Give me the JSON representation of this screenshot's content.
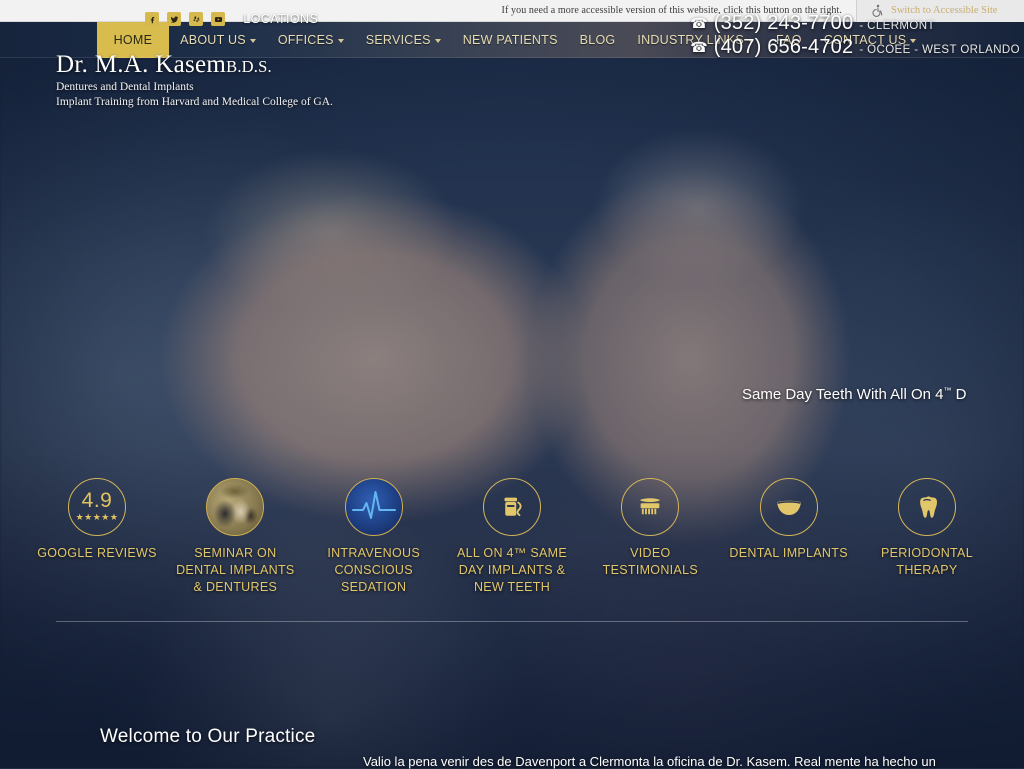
{
  "accessibility_bar": {
    "message": "If you need a more accessible version of this website, click this button on the right.",
    "button_label": "Switch to Accessible Site",
    "icon": "wheelchair-accessibility-icon"
  },
  "nav": {
    "items": [
      {
        "label": "HOME",
        "active": true,
        "has_dropdown": false
      },
      {
        "label": "ABOUT US",
        "active": false,
        "has_dropdown": true
      },
      {
        "label": "OFFICES",
        "active": false,
        "has_dropdown": true
      },
      {
        "label": "SERVICES",
        "active": false,
        "has_dropdown": true
      },
      {
        "label": "NEW PATIENTS",
        "active": false,
        "has_dropdown": false
      },
      {
        "label": "BLOG",
        "active": false,
        "has_dropdown": false
      },
      {
        "label": "INDUSTRY LINKS",
        "active": false,
        "has_dropdown": true
      },
      {
        "label": "FAQ",
        "active": false,
        "has_dropdown": false
      },
      {
        "label": "CONTACT US",
        "active": false,
        "has_dropdown": true
      }
    ],
    "active_bg_color": "#d9bc4e",
    "link_color": "#e8dcb4"
  },
  "logo": {
    "name": "Dr. M.A. Kasem",
    "credential": "B.D.S.",
    "tagline1": "Dentures and Dental Implants",
    "tagline2": "Implant Training from Harvard and Medical College of GA."
  },
  "social": {
    "icons": [
      "facebook-icon",
      "twitter-icon",
      "yelp-icon",
      "youtube-icon"
    ],
    "locations_label": "LOCATIONS",
    "icon_bg_color": "#d6b94e"
  },
  "phones": [
    {
      "icon": "phone-icon",
      "number": "(352) 243-7700",
      "location": "- CLERMONT"
    },
    {
      "icon": "phone-icon",
      "number": "(407) 656-4702",
      "location": "- OCOEE - WEST ORLANDO"
    }
  ],
  "hero": {
    "caption": "Same Day Teeth With All On 4",
    "caption_sup": "™",
    "caption_tail": " D"
  },
  "services": [
    {
      "label": "GOOGLE REVIEWS",
      "icon": "google-rating-icon",
      "rating": "4.9",
      "stars": "★★★★★"
    },
    {
      "label": "SEMINAR ON DENTAL IMPLANTS & DENTURES",
      "icon": "seminar-photo-icon"
    },
    {
      "label": "INTRAVENOUS CONSCIOUS SEDATION",
      "icon": "ekg-heartbeat-icon"
    },
    {
      "label": "ALL ON 4™ SAME DAY IMPLANTS & NEW TEETH",
      "icon": "implant-kit-icon"
    },
    {
      "label": "VIDEO TESTIMONIALS",
      "icon": "toothbrush-icon"
    },
    {
      "label": "DENTAL IMPLANTS",
      "icon": "denture-arch-icon"
    },
    {
      "label": "PERIODONTAL THERAPY",
      "icon": "tooth-icon"
    }
  ],
  "welcome": {
    "title": "Welcome to Our Practice",
    "testimonial": "Valio la pena venir des de Davenport a Clermonta la oficina de Dr. Kasem. Real mente ha hecho un"
  },
  "colors": {
    "gold": "#d9bc4e",
    "gold_text": "#e2c66a",
    "navy": "#16243c",
    "accessible_text": "#c8ad72"
  }
}
